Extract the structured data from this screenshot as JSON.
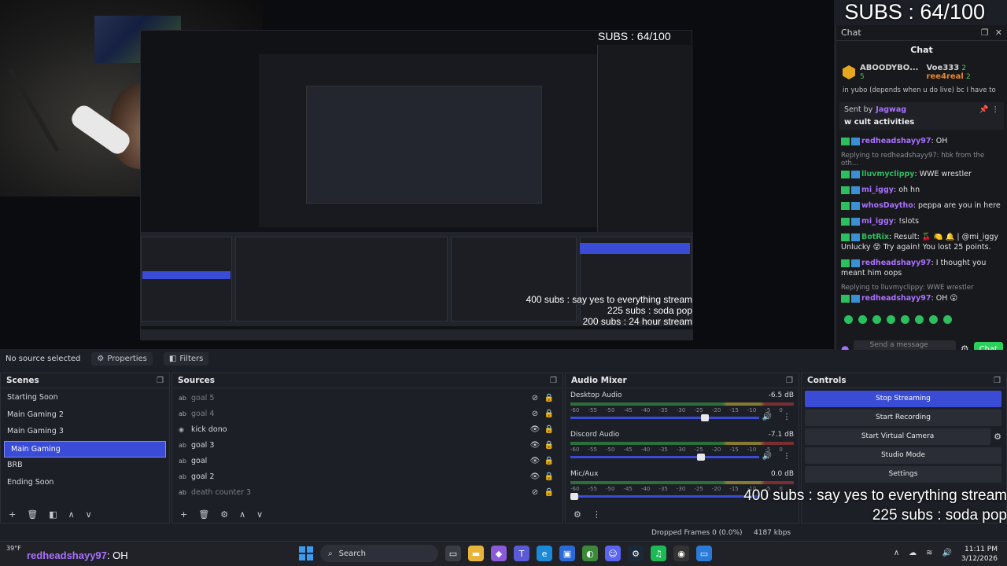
{
  "overlay": {
    "sub_counter": "SUBS : 64/100",
    "goals": [
      "400 subs : say yes to everything stream",
      "225 subs : soda pop",
      "200 subs : 24 hour stream"
    ]
  },
  "chat": {
    "dock_title": "Chat",
    "header": "Chat",
    "leaderboard": [
      {
        "name": "ABOODYBO...",
        "count": "5"
      },
      {
        "name": "Voe333",
        "count": "2"
      },
      {
        "name": "ree4real",
        "count": "2"
      }
    ],
    "pinned_by_prefix": "Sent by",
    "pinned_by": "Jagwag",
    "pinned_message": "w cult activities",
    "truncated_top": "in yubo (depends when u do live) bc I have to",
    "messages": [
      {
        "reply": "",
        "user": "redheadshayy97",
        "color": "#a970ff",
        "text": ": OH"
      },
      {
        "reply": "Replying to redheadshayy97: hbk from the oth...",
        "user": "lluvmyclippy",
        "color": "#2bbf60",
        "text": ": WWE wrestler"
      },
      {
        "reply": "",
        "user": "mi_iggy",
        "color": "#a970ff",
        "text": ": oh hn"
      },
      {
        "reply": "",
        "user": "whosDaytho",
        "color": "#a970ff",
        "text": ": peppa are you in here"
      },
      {
        "reply": "",
        "user": "mi_iggy",
        "color": "#a970ff",
        "text": ": !slots"
      },
      {
        "reply": "",
        "user": "BotRix",
        "color": "#2bbf60",
        "text": ": Result: 🍒 🍋 🔔 | @mi_iggy Unlucky 😵 Try again! You lost 25 points."
      },
      {
        "reply": "",
        "user": "redheadshayy97",
        "color": "#a970ff",
        "text": ": I thought you meant him oops"
      },
      {
        "reply": "Replying to lluvmyclippy: WWE wrestler",
        "user": "redheadshayy97",
        "color": "#a970ff",
        "text": ": OH 😮"
      }
    ],
    "input_placeholder": "Send a message",
    "send_button": "Chat"
  },
  "obs": {
    "no_source_selected": "No source selected",
    "properties_label": "Properties",
    "filters_label": "Filters",
    "scenes_title": "Scenes",
    "scenes": [
      "Starting Soon",
      "Main Gaming 2",
      "Main Gaming 3",
      "Main Gaming",
      "BRB",
      "Ending Soon"
    ],
    "active_scene_index": 3,
    "sources_title": "Sources",
    "sources": [
      {
        "name": "goal 5",
        "visible": false
      },
      {
        "name": "goal 4",
        "visible": false
      },
      {
        "name": "kick dono",
        "visible": true
      },
      {
        "name": "goal 3",
        "visible": true
      },
      {
        "name": "goal",
        "visible": true
      },
      {
        "name": "goal 2",
        "visible": true
      },
      {
        "name": "death counter 3",
        "visible": false
      }
    ],
    "mixer_title": "Audio Mixer",
    "mixer": [
      {
        "name": "Desktop Audio",
        "db": "-6.5 dB",
        "level": 0.72
      },
      {
        "name": "Discord Audio",
        "db": "-7.1 dB",
        "level": 0.7
      },
      {
        "name": "Mic/Aux",
        "db": "0.0 dB",
        "level": 0.0
      }
    ],
    "mixer_scale": [
      "-60",
      "-55",
      "-50",
      "-45",
      "-40",
      "-35",
      "-30",
      "-25",
      "-20",
      "-15",
      "-10",
      "-5",
      "0"
    ],
    "controls_title": "Controls",
    "controls": [
      "Stop Streaming",
      "Start Recording",
      "Start Virtual Camera",
      "Studio Mode",
      "Settings"
    ],
    "status": {
      "dropped": "Dropped Frames 0 (0.0%)",
      "kbps": "4187 kbps"
    }
  },
  "taskbar": {
    "weather": "39°F",
    "chat_user": "redheadshayy97",
    "chat_text": ": OH",
    "search": "Search",
    "time": "11:11 PM",
    "date": "3/12/2026"
  },
  "colors": {
    "accent": "#3a4bd6",
    "chat_green": "#2ad05a",
    "panel": "#1d1f26"
  },
  "icons": [
    "search-icon",
    "windows-icon",
    "gear-icon",
    "eye-icon",
    "lock-icon",
    "plus-icon",
    "trash-icon",
    "chevron-up-icon",
    "chevron-down-icon",
    "speaker-icon",
    "pin-icon"
  ]
}
